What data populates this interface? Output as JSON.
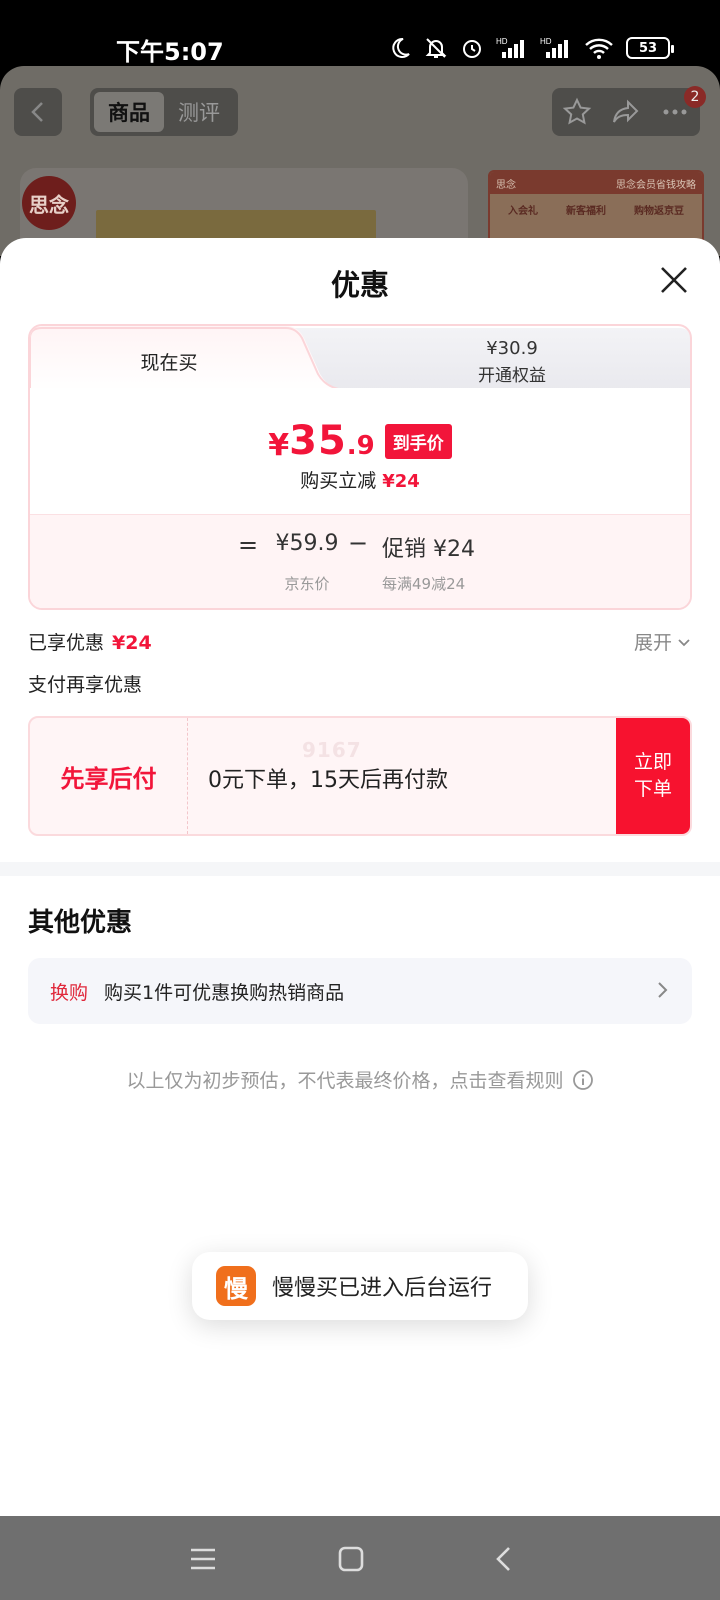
{
  "status_bar": {
    "time": "下午5:07",
    "battery": "53"
  },
  "background": {
    "tabs": [
      "商品",
      "测评"
    ],
    "badge": "2",
    "brand": "思念",
    "promo_header": "思念会员省钱攻略",
    "promo_items": [
      "入会礼",
      "新客福利",
      "购物返京豆"
    ]
  },
  "sheet": {
    "title": "优惠",
    "tabs": {
      "active": "现在买",
      "other_price": "¥30.9",
      "other_label": "开通权益"
    },
    "price": {
      "yen": "¥",
      "integer": "35",
      "decimal": ".9",
      "tag": "到手价"
    },
    "reduce": {
      "label": "购买立减",
      "amount": "¥24"
    },
    "formula": {
      "eq": "=",
      "jd_price": "¥59.9",
      "jd_label": "京东价",
      "minus": "−",
      "promo_price": "促销 ¥24",
      "promo_label": "每满49减24"
    },
    "enjoyed": {
      "label": "已享优惠",
      "amount": "¥24"
    },
    "expand": "展开",
    "pay_more": "支付再享优惠",
    "bnpl": {
      "title": "先享后付",
      "desc": "0元下单，15天后再付款",
      "watermark": "9167",
      "button": "立即下单"
    },
    "other": {
      "title": "其他优惠",
      "swap_tag": "换购",
      "swap_text": "购买1件可优惠换购热销商品"
    },
    "disclaimer": "以上仅为初步预估，不代表最终价格，点击查看规则"
  },
  "toast": {
    "icon_char": "慢",
    "text": "慢慢买已进入后台运行"
  },
  "colors": {
    "accent": "#f2153a",
    "button": "#f7122f",
    "card_border": "#fbd5d9"
  }
}
